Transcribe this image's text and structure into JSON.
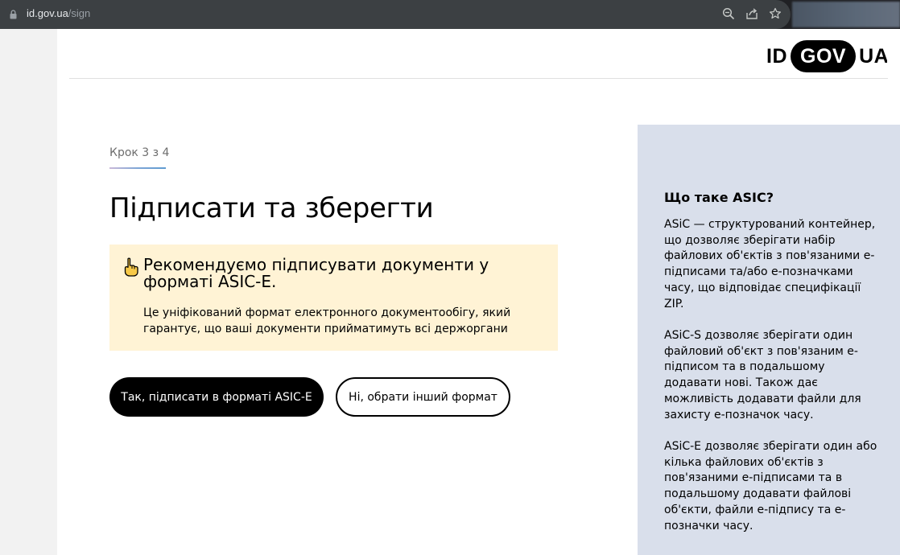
{
  "browser": {
    "url_host": "id.gov.ua",
    "url_path": "/sign",
    "icons": [
      "lock-icon",
      "zoom-icon",
      "share-icon",
      "bookmark-star-icon"
    ]
  },
  "header": {
    "logo_left": "ID",
    "logo_pill": "GOV",
    "logo_right": "UA"
  },
  "main": {
    "step": "Крок 3 з 4",
    "title": "Підписати та зберегти",
    "notice": {
      "icon": "pointing-hand-icon",
      "heading": "Рекомендуємо підписувати документи у форматі ASIC-E.",
      "text": "Це уніфікований формат електронного документообігу, який гарантує, що ваші документи прийматимуть всі держоргани"
    },
    "buttons": {
      "primary": "Так, підписати в форматі ASIC-E",
      "secondary": "Ні, обрати інший формат"
    }
  },
  "aside": {
    "title": "Що таке ASIC?",
    "paragraphs": [
      "ASiC — структурований контейнер, що дозволяє зберігати набір файлових об'єктів з пов'язаними е-підписами та/або е-позначками часу, що відповідає специфікації ZIP.",
      "ASiC-S дозволяє зберігати один файловий об'єкт з пов'язаним е-підписом та в подальшому додавати нові. Також дає можливість додавати файли для захисту е-позначок часу.",
      "ASiC-E дозволяє зберігати один або кілька файлових об'єктів з пов'язаними е-підписами та в подальшому додавати файлові об'єкти, файли е-підпису та е-позначки часу."
    ]
  },
  "colors": {
    "notice_bg": "#fff3d5",
    "aside_bg": "#d9dfeb",
    "primary_button_bg": "#000000"
  }
}
